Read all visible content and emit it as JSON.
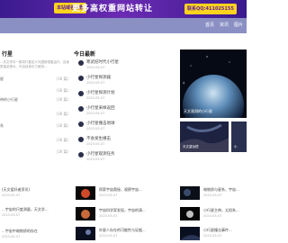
{
  "promo": {
    "badge": "本站域名出售",
    "text": "更多高权重网站转让",
    "contact": "联系QQ:411025155"
  },
  "nav": {
    "items": [
      "首页",
      "资讯",
      "图片"
    ]
  },
  "left": {
    "title": "行星",
    "desc": "...天文学中一般将行星定义为围绕恒星运行、自身质量足够大、可由自身引力维持...",
    "rows": [
      {
        "label": "星",
        "count": "(38 篇)"
      },
      {
        "label": "",
        "count": "(38 篇)"
      },
      {
        "label": "带的小行星",
        "count": "(38 篇)"
      },
      {
        "label": "",
        "count": "(38 篇)"
      },
      {
        "label": "系",
        "count": "(38 篇)"
      },
      {
        "label": "",
        "count": "(38 篇)"
      },
      {
        "label": "",
        "count": "(38 篇)"
      }
    ]
  },
  "news": {
    "title": "今日最新",
    "items": [
      {
        "title": "寒武纪时代小行星",
        "date": "2023-05-07"
      },
      {
        "title": "小行星探测器",
        "date": "2023-05-07"
      },
      {
        "title": "小行星探测计划",
        "date": "2023-05-07"
      },
      {
        "title": "小行星采样返回",
        "date": "2023-05-07"
      },
      {
        "title": "小行星撞击地球",
        "date": "2023-05-07"
      },
      {
        "title": "不会发生撞击",
        "date": "2023-05-07"
      },
      {
        "title": "小行星观测任务",
        "date": "2023-05-07"
      }
    ]
  },
  "slider": {
    "caption": "天文观测的小行星",
    "thumbs": [
      "天文望远镜",
      "小"
    ]
  },
  "bottom": {
    "left_rows": [
      {
        "text": "(天文爱好者资讯)",
        "date": "2023-05-07"
      },
      {
        "text": "...宇宙的尺度测量，天文学...",
        "date": "2023-05-07"
      },
      {
        "text": "...宇宙中暗物质的存在",
        "date": "2023-05-07"
      }
    ],
    "mid_rows": [
      {
        "text": "探索宇宙奥秘、观察宇宙...",
        "date": "2023-05-07"
      },
      {
        "text": "宇宙科学家发现，宇宙的演...",
        "date": "2023-05-07"
      },
      {
        "text": "外星人存在的可能性与证据...",
        "date": "2023-05-07"
      }
    ],
    "right_rows": [
      {
        "text": "暗物质与星系，宇宙...",
        "date": "2023-05-07"
      },
      {
        "text": "小行星主带，太阳系...",
        "date": "2023-05-07"
      },
      {
        "text": "小行星撞击事件...",
        "date": "2023-05-07"
      }
    ]
  }
}
